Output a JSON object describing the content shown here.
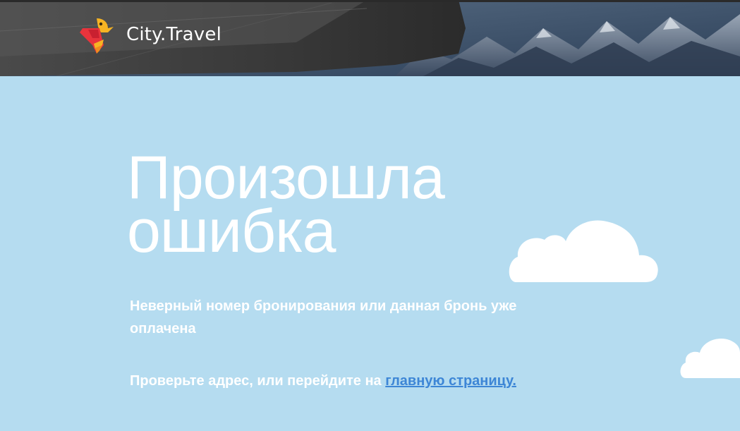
{
  "header": {
    "brand_name": "City.Travel",
    "logo_icon": "parrot-logo-icon",
    "background": "airplane-wing-over-mountains-photo"
  },
  "main": {
    "title": "Произошла ошибка",
    "message": "Неверный номер бронирования или данная бронь уже оплачена",
    "hint_prefix": "Проверьте адрес, или перейдите на ",
    "home_link": "главную страницу."
  },
  "colors": {
    "background": "#b5dcf0",
    "text": "#ffffff",
    "link": "#3d86d6",
    "logo_red": "#e8343c",
    "logo_yellow": "#f7b423"
  },
  "decorations": {
    "cloud_icon": "cloud-icon"
  }
}
